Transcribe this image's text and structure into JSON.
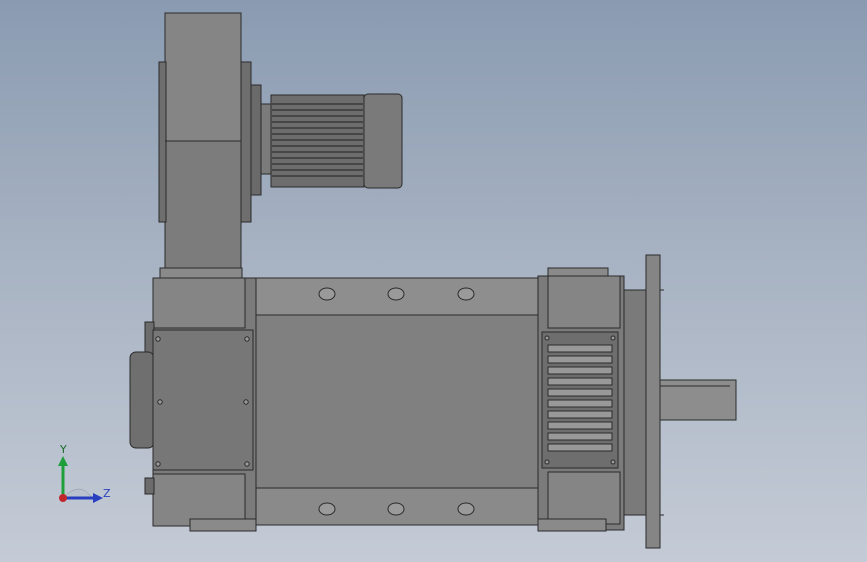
{
  "viewport": {
    "background_top": "#8a9bb1",
    "background_bottom": "#c4cbd6"
  },
  "model": {
    "body_color": "#7a7a7a",
    "edge_color": "#2a2a2a",
    "highlight_color": "#9a9a9a"
  },
  "triad": {
    "y_label": "Y",
    "z_label": "Z",
    "y_color": "#1f9e3a",
    "z_color": "#2a3fbf",
    "x_color": "#c0262c"
  }
}
